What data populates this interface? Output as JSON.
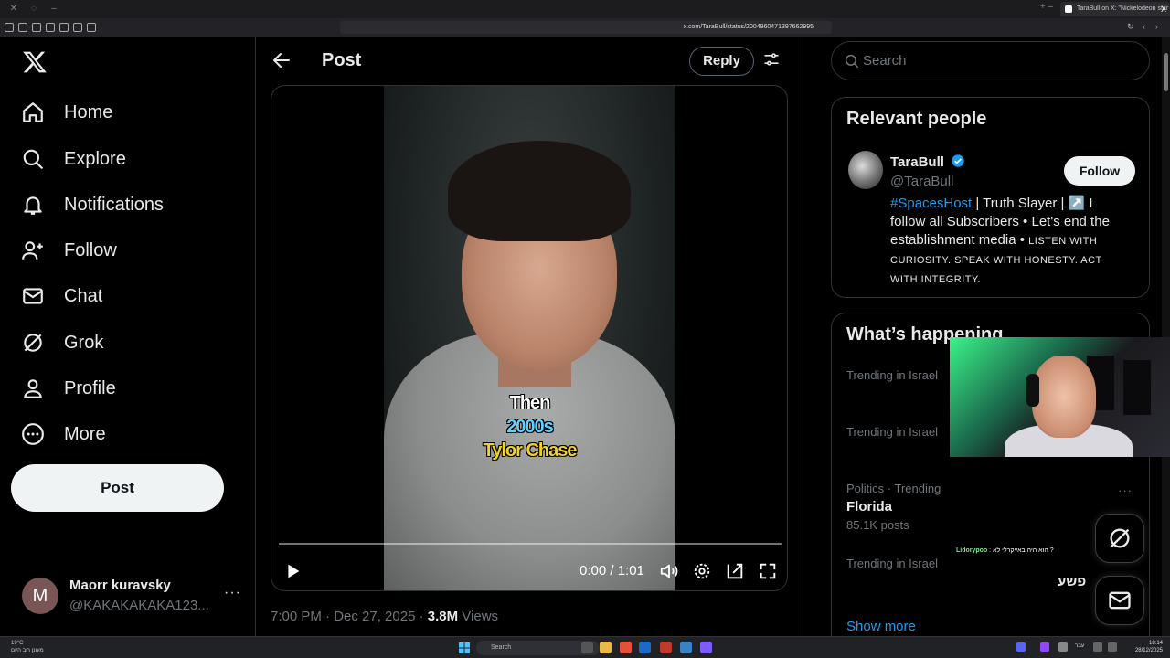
{
  "browser": {
    "tab_title": "TaraBull on X: \"Nickelodeon star",
    "url": "x.com/TaraBull/status/2004960471397662995"
  },
  "nav": {
    "items": [
      {
        "label": "Home",
        "icon": "home-icon"
      },
      {
        "label": "Explore",
        "icon": "search-icon"
      },
      {
        "label": "Notifications",
        "icon": "bell-icon"
      },
      {
        "label": "Follow",
        "icon": "person-add-icon"
      },
      {
        "label": "Chat",
        "icon": "mail-icon"
      },
      {
        "label": "Grok",
        "icon": "grok-icon"
      },
      {
        "label": "Profile",
        "icon": "person-icon"
      },
      {
        "label": "More",
        "icon": "more-circle-icon"
      }
    ],
    "post_label": "Post",
    "account": {
      "initial": "M",
      "name": "Maorr kuravsky",
      "handle": "@KAKAKAKAKA123...",
      "more": "···"
    }
  },
  "main": {
    "title": "Post",
    "reply_label": "Reply",
    "video": {
      "caption_lines": [
        "Then",
        "2000s",
        "Tylor Chase"
      ],
      "time": "0:00 / 1:01",
      "progress": 0.0
    },
    "meta": {
      "time": "7:00 PM · Dec 27, 2025 · ",
      "views": "3.8M",
      "views_label": " Views"
    }
  },
  "sidebar": {
    "search_placeholder": "Search",
    "relevant": {
      "title": "Relevant people",
      "name": "TaraBull",
      "handle": "@TaraBull",
      "follow_label": "Follow",
      "bio_tag": "#SpacesHost",
      "bio_main": " | Truth Slayer | ↗️ I follow all Subscribers • Let's end the establishment media • ",
      "bio_small": "LISTEN WITH CURIOSITY. SPEAK WITH HONESTY. ACT WITH INTEGRITY."
    },
    "happening": {
      "title": "What’s happening",
      "trends": [
        {
          "context": "Trending in Israel",
          "name": "",
          "count": ""
        },
        {
          "context": "Trending in Israel",
          "name": "",
          "count": ""
        },
        {
          "context": "Politics · Trending",
          "name": "Florida",
          "count": "85.1K posts"
        },
        {
          "context": "Trending in Israel",
          "name": "",
          "count": ""
        }
      ],
      "more": "···",
      "show_more": "Show more"
    }
  },
  "overlay": {
    "chat_user": "Lidorypoo",
    "chat_text": " : הוא היה באייקרלי לא ?",
    "partial_text": "פשע"
  },
  "taskbar": {
    "weather_temp": "19°C",
    "weather_desc": "מעונן רוב היום",
    "search_label": "Search",
    "time": "18:14",
    "date": "28/12/2025",
    "lang": "עבר"
  },
  "colors": {
    "accent": "#1d9bf0",
    "bg": "#000000",
    "border": "#2f3336",
    "muted": "#71767b"
  }
}
